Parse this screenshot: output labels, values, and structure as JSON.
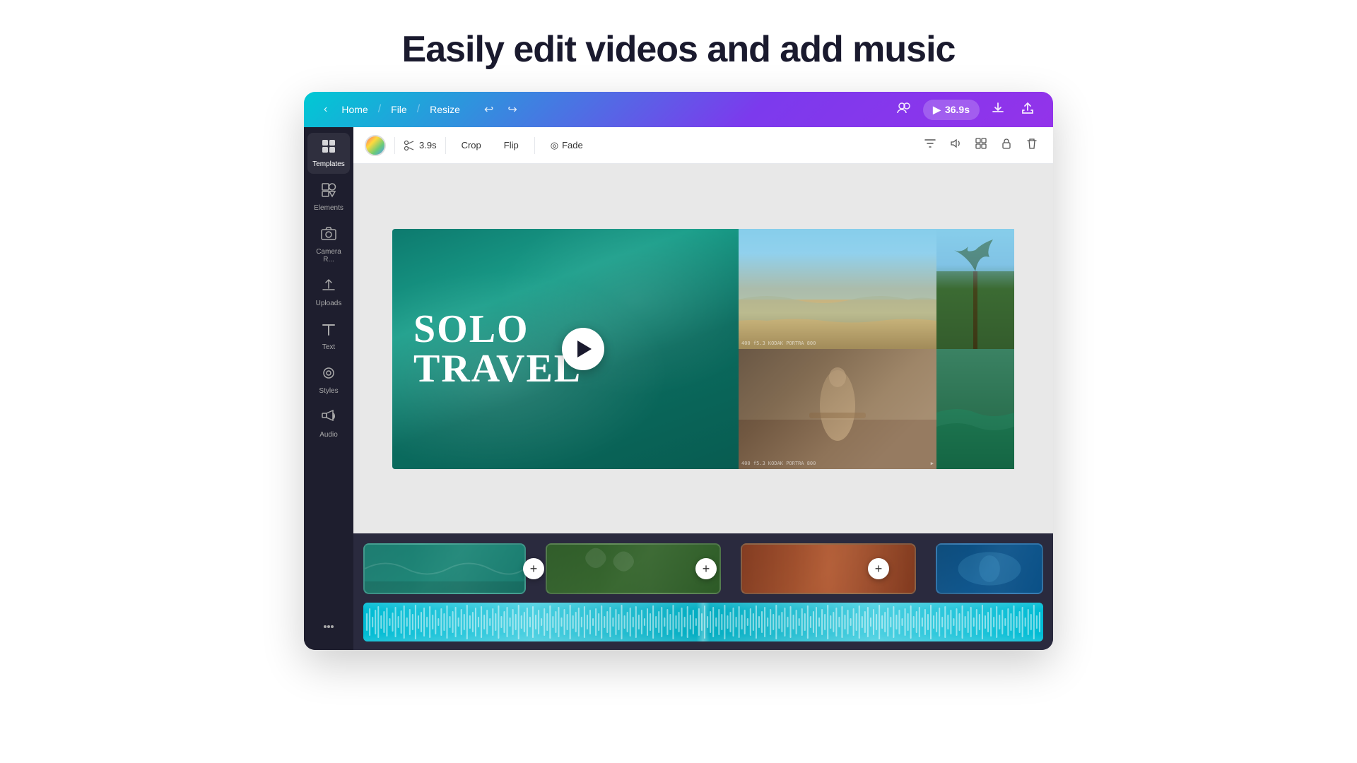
{
  "page": {
    "title": "Easily edit videos and add music"
  },
  "topbar": {
    "home": "Home",
    "file": "File",
    "resize": "Resize",
    "duration": "36.9s",
    "undo_icon": "↩",
    "redo_icon": "↪",
    "download_icon": "⬇",
    "share_icon": "⬆",
    "collaborate_icon": "👥",
    "play_icon": "▶"
  },
  "toolbar": {
    "duration": "3.9s",
    "crop": "Crop",
    "flip": "Flip",
    "fade": "Fade"
  },
  "sidebar": {
    "items": [
      {
        "id": "templates",
        "label": "Templates",
        "icon": "⊞"
      },
      {
        "id": "elements",
        "label": "Elements",
        "icon": "◇◈"
      },
      {
        "id": "camera",
        "label": "Camera R...",
        "icon": "📷"
      },
      {
        "id": "uploads",
        "label": "Uploads",
        "icon": "⬆"
      },
      {
        "id": "text",
        "label": "Text",
        "icon": "T"
      },
      {
        "id": "styles",
        "label": "Styles",
        "icon": "◎"
      },
      {
        "id": "audio",
        "label": "Audio",
        "icon": "♪"
      },
      {
        "id": "more",
        "label": "...",
        "icon": "•••"
      }
    ]
  },
  "canvas": {
    "title_line1": "SOLO",
    "title_line2": "TRAVEL"
  },
  "timeline": {
    "clips": [
      {
        "id": "clip-1",
        "color_start": "#1a7a6e",
        "color_end": "#2d9e8a"
      },
      {
        "id": "clip-2",
        "color_start": "#2d5a27",
        "color_end": "#4a7c3f"
      },
      {
        "id": "clip-3",
        "color_start": "#6b3a1e",
        "color_end": "#8b5a30"
      },
      {
        "id": "clip-4",
        "color_start": "#0a4a7a",
        "color_end": "#1a6aaa"
      }
    ],
    "add_label": "+"
  },
  "colors": {
    "topbar_gradient_start": "#00c9d4",
    "topbar_gradient_end": "#9333ea",
    "sidebar_bg": "#1e1e2e",
    "canvas_bg": "#e8e8e8",
    "timeline_bg": "#2a2a3e",
    "audio_color": "#00bcd4",
    "accent_blue": "#4d96ff"
  }
}
